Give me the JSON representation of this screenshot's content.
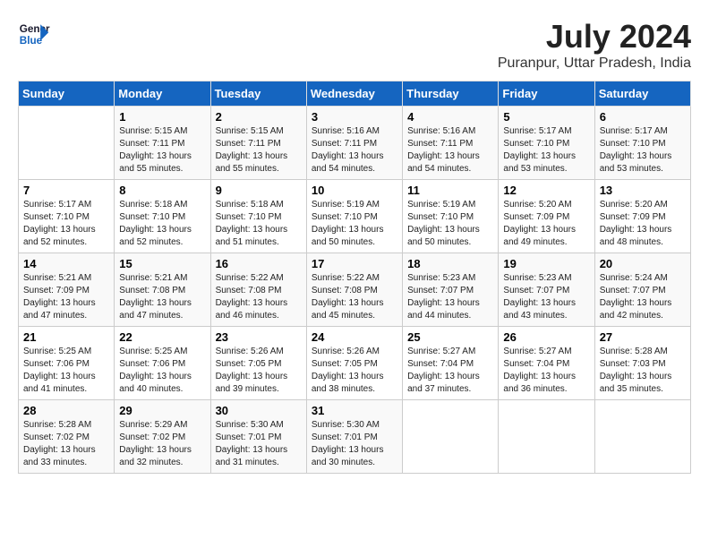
{
  "logo": {
    "line1": "General",
    "line2": "Blue"
  },
  "title": "July 2024",
  "location": "Puranpur, Uttar Pradesh, India",
  "days_of_week": [
    "Sunday",
    "Monday",
    "Tuesday",
    "Wednesday",
    "Thursday",
    "Friday",
    "Saturday"
  ],
  "weeks": [
    [
      {
        "day": "",
        "sunrise": "",
        "sunset": "",
        "daylight": ""
      },
      {
        "day": "1",
        "sunrise": "5:15 AM",
        "sunset": "7:11 PM",
        "daylight": "13 hours and 55 minutes."
      },
      {
        "day": "2",
        "sunrise": "5:15 AM",
        "sunset": "7:11 PM",
        "daylight": "13 hours and 55 minutes."
      },
      {
        "day": "3",
        "sunrise": "5:16 AM",
        "sunset": "7:11 PM",
        "daylight": "13 hours and 54 minutes."
      },
      {
        "day": "4",
        "sunrise": "5:16 AM",
        "sunset": "7:11 PM",
        "daylight": "13 hours and 54 minutes."
      },
      {
        "day": "5",
        "sunrise": "5:17 AM",
        "sunset": "7:10 PM",
        "daylight": "13 hours and 53 minutes."
      },
      {
        "day": "6",
        "sunrise": "5:17 AM",
        "sunset": "7:10 PM",
        "daylight": "13 hours and 53 minutes."
      }
    ],
    [
      {
        "day": "7",
        "sunrise": "5:17 AM",
        "sunset": "7:10 PM",
        "daylight": "13 hours and 52 minutes."
      },
      {
        "day": "8",
        "sunrise": "5:18 AM",
        "sunset": "7:10 PM",
        "daylight": "13 hours and 52 minutes."
      },
      {
        "day": "9",
        "sunrise": "5:18 AM",
        "sunset": "7:10 PM",
        "daylight": "13 hours and 51 minutes."
      },
      {
        "day": "10",
        "sunrise": "5:19 AM",
        "sunset": "7:10 PM",
        "daylight": "13 hours and 50 minutes."
      },
      {
        "day": "11",
        "sunrise": "5:19 AM",
        "sunset": "7:10 PM",
        "daylight": "13 hours and 50 minutes."
      },
      {
        "day": "12",
        "sunrise": "5:20 AM",
        "sunset": "7:09 PM",
        "daylight": "13 hours and 49 minutes."
      },
      {
        "day": "13",
        "sunrise": "5:20 AM",
        "sunset": "7:09 PM",
        "daylight": "13 hours and 48 minutes."
      }
    ],
    [
      {
        "day": "14",
        "sunrise": "5:21 AM",
        "sunset": "7:09 PM",
        "daylight": "13 hours and 47 minutes."
      },
      {
        "day": "15",
        "sunrise": "5:21 AM",
        "sunset": "7:08 PM",
        "daylight": "13 hours and 47 minutes."
      },
      {
        "day": "16",
        "sunrise": "5:22 AM",
        "sunset": "7:08 PM",
        "daylight": "13 hours and 46 minutes."
      },
      {
        "day": "17",
        "sunrise": "5:22 AM",
        "sunset": "7:08 PM",
        "daylight": "13 hours and 45 minutes."
      },
      {
        "day": "18",
        "sunrise": "5:23 AM",
        "sunset": "7:07 PM",
        "daylight": "13 hours and 44 minutes."
      },
      {
        "day": "19",
        "sunrise": "5:23 AM",
        "sunset": "7:07 PM",
        "daylight": "13 hours and 43 minutes."
      },
      {
        "day": "20",
        "sunrise": "5:24 AM",
        "sunset": "7:07 PM",
        "daylight": "13 hours and 42 minutes."
      }
    ],
    [
      {
        "day": "21",
        "sunrise": "5:25 AM",
        "sunset": "7:06 PM",
        "daylight": "13 hours and 41 minutes."
      },
      {
        "day": "22",
        "sunrise": "5:25 AM",
        "sunset": "7:06 PM",
        "daylight": "13 hours and 40 minutes."
      },
      {
        "day": "23",
        "sunrise": "5:26 AM",
        "sunset": "7:05 PM",
        "daylight": "13 hours and 39 minutes."
      },
      {
        "day": "24",
        "sunrise": "5:26 AM",
        "sunset": "7:05 PM",
        "daylight": "13 hours and 38 minutes."
      },
      {
        "day": "25",
        "sunrise": "5:27 AM",
        "sunset": "7:04 PM",
        "daylight": "13 hours and 37 minutes."
      },
      {
        "day": "26",
        "sunrise": "5:27 AM",
        "sunset": "7:04 PM",
        "daylight": "13 hours and 36 minutes."
      },
      {
        "day": "27",
        "sunrise": "5:28 AM",
        "sunset": "7:03 PM",
        "daylight": "13 hours and 35 minutes."
      }
    ],
    [
      {
        "day": "28",
        "sunrise": "5:28 AM",
        "sunset": "7:02 PM",
        "daylight": "13 hours and 33 minutes."
      },
      {
        "day": "29",
        "sunrise": "5:29 AM",
        "sunset": "7:02 PM",
        "daylight": "13 hours and 32 minutes."
      },
      {
        "day": "30",
        "sunrise": "5:30 AM",
        "sunset": "7:01 PM",
        "daylight": "13 hours and 31 minutes."
      },
      {
        "day": "31",
        "sunrise": "5:30 AM",
        "sunset": "7:01 PM",
        "daylight": "13 hours and 30 minutes."
      },
      {
        "day": "",
        "sunrise": "",
        "sunset": "",
        "daylight": ""
      },
      {
        "day": "",
        "sunrise": "",
        "sunset": "",
        "daylight": ""
      },
      {
        "day": "",
        "sunrise": "",
        "sunset": "",
        "daylight": ""
      }
    ]
  ]
}
